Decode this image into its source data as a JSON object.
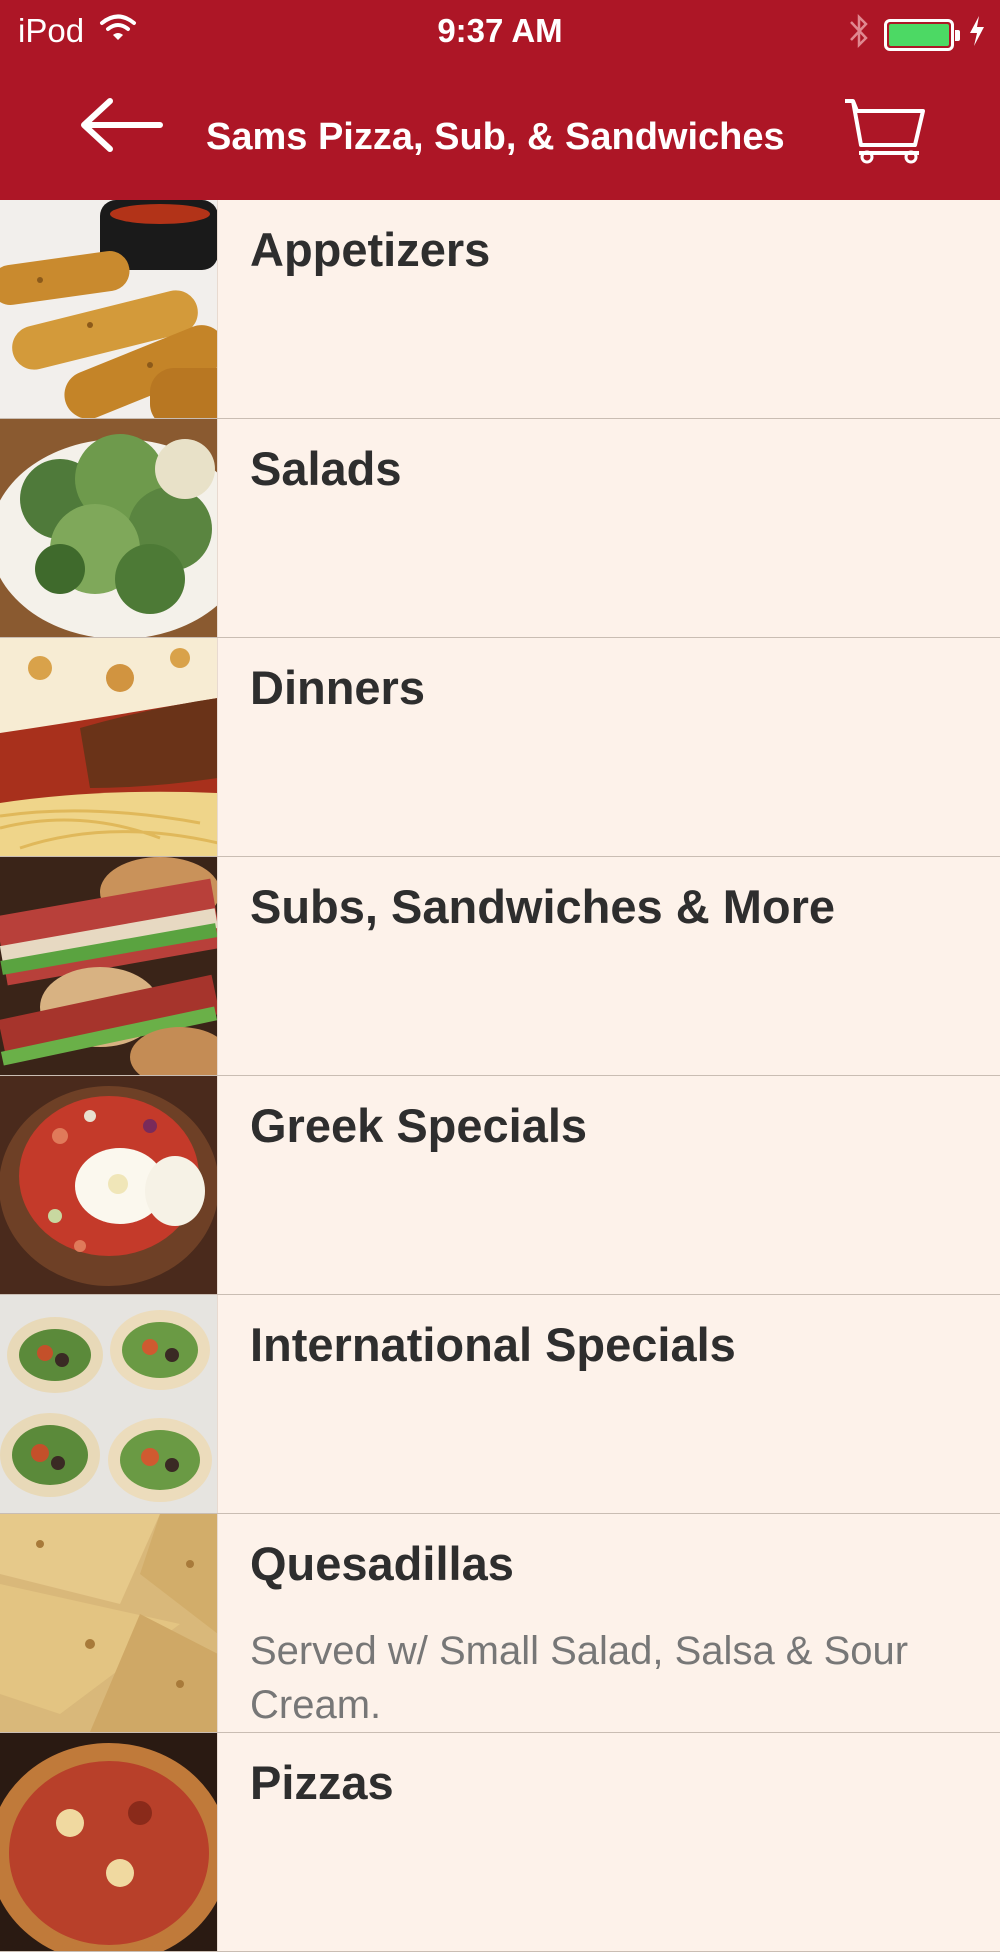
{
  "status_bar": {
    "carrier": "iPod",
    "time": "9:37 AM",
    "battery_color": "#4cd964"
  },
  "nav": {
    "title": "Sams Pizza, Sub, & Sandwiches",
    "back_icon": "arrow-left-icon",
    "cart_icon": "cart-icon",
    "background": "#ad1626"
  },
  "categories": [
    {
      "name": "Appetizers",
      "description": "",
      "image": "mozzarella-sticks-photo"
    },
    {
      "name": "Salads",
      "description": "",
      "image": "caesar-salad-photo"
    },
    {
      "name": "Dinners",
      "description": "",
      "image": "chicken-parmesan-photo"
    },
    {
      "name": "Subs, Sandwiches & More",
      "description": "",
      "image": "subs-photo"
    },
    {
      "name": "Greek Specials",
      "description": "",
      "image": "greek-special-photo"
    },
    {
      "name": "International Specials",
      "description": "",
      "image": "wraps-photo"
    },
    {
      "name": "Quesadillas",
      "description": "Served w/ Small Salad, Salsa & Sour Cream.",
      "image": "quesadillas-photo"
    },
    {
      "name": "Pizzas",
      "description": "",
      "image": "pizza-photo"
    }
  ]
}
